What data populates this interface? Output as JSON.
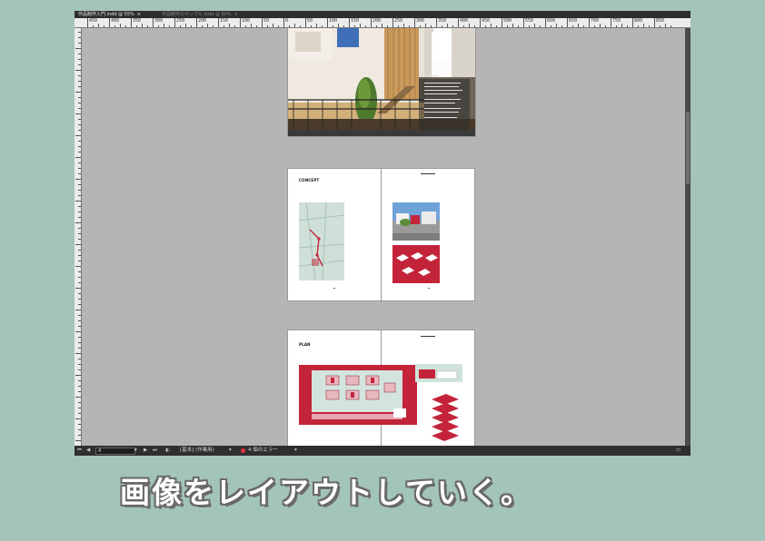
{
  "window": {
    "tabs": [
      {
        "label": "作品制作入門.indd @ 55%",
        "active": true
      },
      {
        "label": "作品制作のサンプル.indd @ 50%",
        "active": false
      }
    ],
    "ruler_labels": [
      "450",
      "400",
      "350",
      "300",
      "250",
      "200",
      "150",
      "100",
      "50",
      "0",
      "50",
      "100",
      "150",
      "200",
      "250",
      "300",
      "350",
      "400",
      "450",
      "500",
      "550",
      "600",
      "650",
      "700",
      "750",
      "800",
      "850"
    ]
  },
  "spreads": {
    "concept_title": "CONCEPT",
    "plan_title": "PLAN"
  },
  "statusbar": {
    "page_field": "4",
    "profile": "[基本] (作業用)",
    "errors": "4 個のエラー"
  },
  "caption": "画像をレイアウトしていく。",
  "colors": {
    "accent_red": "#c3243a",
    "canvas_gray": "#b5b5b5",
    "background": "#a3c4bb"
  }
}
